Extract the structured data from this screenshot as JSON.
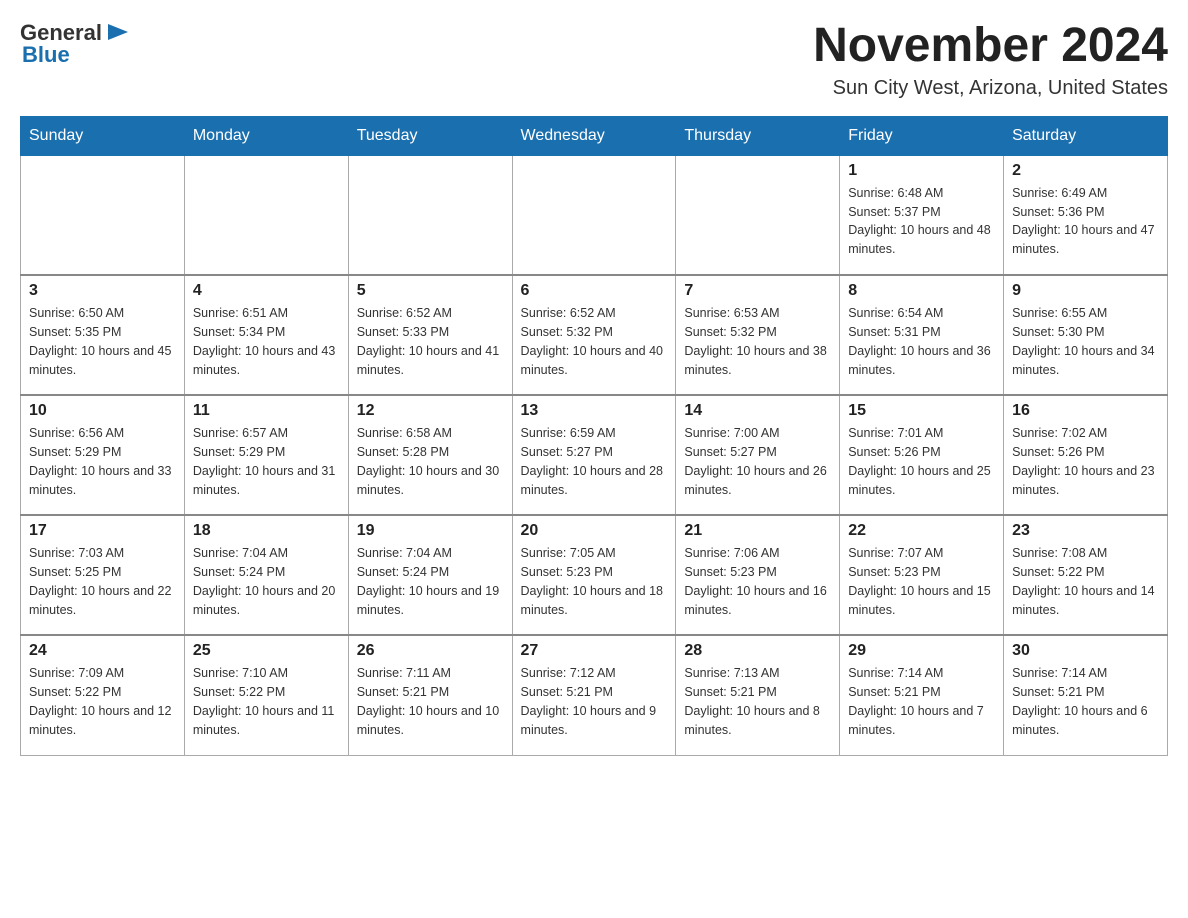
{
  "header": {
    "logo": {
      "text_general": "General",
      "text_blue": "Blue",
      "icon": "▶"
    },
    "month_title": "November 2024",
    "location": "Sun City West, Arizona, United States"
  },
  "weekdays": [
    "Sunday",
    "Monday",
    "Tuesday",
    "Wednesday",
    "Thursday",
    "Friday",
    "Saturday"
  ],
  "weeks": [
    {
      "days": [
        {
          "number": "",
          "info": ""
        },
        {
          "number": "",
          "info": ""
        },
        {
          "number": "",
          "info": ""
        },
        {
          "number": "",
          "info": ""
        },
        {
          "number": "",
          "info": ""
        },
        {
          "number": "1",
          "info": "Sunrise: 6:48 AM\nSunset: 5:37 PM\nDaylight: 10 hours and 48 minutes."
        },
        {
          "number": "2",
          "info": "Sunrise: 6:49 AM\nSunset: 5:36 PM\nDaylight: 10 hours and 47 minutes."
        }
      ]
    },
    {
      "days": [
        {
          "number": "3",
          "info": "Sunrise: 6:50 AM\nSunset: 5:35 PM\nDaylight: 10 hours and 45 minutes."
        },
        {
          "number": "4",
          "info": "Sunrise: 6:51 AM\nSunset: 5:34 PM\nDaylight: 10 hours and 43 minutes."
        },
        {
          "number": "5",
          "info": "Sunrise: 6:52 AM\nSunset: 5:33 PM\nDaylight: 10 hours and 41 minutes."
        },
        {
          "number": "6",
          "info": "Sunrise: 6:52 AM\nSunset: 5:32 PM\nDaylight: 10 hours and 40 minutes."
        },
        {
          "number": "7",
          "info": "Sunrise: 6:53 AM\nSunset: 5:32 PM\nDaylight: 10 hours and 38 minutes."
        },
        {
          "number": "8",
          "info": "Sunrise: 6:54 AM\nSunset: 5:31 PM\nDaylight: 10 hours and 36 minutes."
        },
        {
          "number": "9",
          "info": "Sunrise: 6:55 AM\nSunset: 5:30 PM\nDaylight: 10 hours and 34 minutes."
        }
      ]
    },
    {
      "days": [
        {
          "number": "10",
          "info": "Sunrise: 6:56 AM\nSunset: 5:29 PM\nDaylight: 10 hours and 33 minutes."
        },
        {
          "number": "11",
          "info": "Sunrise: 6:57 AM\nSunset: 5:29 PM\nDaylight: 10 hours and 31 minutes."
        },
        {
          "number": "12",
          "info": "Sunrise: 6:58 AM\nSunset: 5:28 PM\nDaylight: 10 hours and 30 minutes."
        },
        {
          "number": "13",
          "info": "Sunrise: 6:59 AM\nSunset: 5:27 PM\nDaylight: 10 hours and 28 minutes."
        },
        {
          "number": "14",
          "info": "Sunrise: 7:00 AM\nSunset: 5:27 PM\nDaylight: 10 hours and 26 minutes."
        },
        {
          "number": "15",
          "info": "Sunrise: 7:01 AM\nSunset: 5:26 PM\nDaylight: 10 hours and 25 minutes."
        },
        {
          "number": "16",
          "info": "Sunrise: 7:02 AM\nSunset: 5:26 PM\nDaylight: 10 hours and 23 minutes."
        }
      ]
    },
    {
      "days": [
        {
          "number": "17",
          "info": "Sunrise: 7:03 AM\nSunset: 5:25 PM\nDaylight: 10 hours and 22 minutes."
        },
        {
          "number": "18",
          "info": "Sunrise: 7:04 AM\nSunset: 5:24 PM\nDaylight: 10 hours and 20 minutes."
        },
        {
          "number": "19",
          "info": "Sunrise: 7:04 AM\nSunset: 5:24 PM\nDaylight: 10 hours and 19 minutes."
        },
        {
          "number": "20",
          "info": "Sunrise: 7:05 AM\nSunset: 5:23 PM\nDaylight: 10 hours and 18 minutes."
        },
        {
          "number": "21",
          "info": "Sunrise: 7:06 AM\nSunset: 5:23 PM\nDaylight: 10 hours and 16 minutes."
        },
        {
          "number": "22",
          "info": "Sunrise: 7:07 AM\nSunset: 5:23 PM\nDaylight: 10 hours and 15 minutes."
        },
        {
          "number": "23",
          "info": "Sunrise: 7:08 AM\nSunset: 5:22 PM\nDaylight: 10 hours and 14 minutes."
        }
      ]
    },
    {
      "days": [
        {
          "number": "24",
          "info": "Sunrise: 7:09 AM\nSunset: 5:22 PM\nDaylight: 10 hours and 12 minutes."
        },
        {
          "number": "25",
          "info": "Sunrise: 7:10 AM\nSunset: 5:22 PM\nDaylight: 10 hours and 11 minutes."
        },
        {
          "number": "26",
          "info": "Sunrise: 7:11 AM\nSunset: 5:21 PM\nDaylight: 10 hours and 10 minutes."
        },
        {
          "number": "27",
          "info": "Sunrise: 7:12 AM\nSunset: 5:21 PM\nDaylight: 10 hours and 9 minutes."
        },
        {
          "number": "28",
          "info": "Sunrise: 7:13 AM\nSunset: 5:21 PM\nDaylight: 10 hours and 8 minutes."
        },
        {
          "number": "29",
          "info": "Sunrise: 7:14 AM\nSunset: 5:21 PM\nDaylight: 10 hours and 7 minutes."
        },
        {
          "number": "30",
          "info": "Sunrise: 7:14 AM\nSunset: 5:21 PM\nDaylight: 10 hours and 6 minutes."
        }
      ]
    }
  ]
}
